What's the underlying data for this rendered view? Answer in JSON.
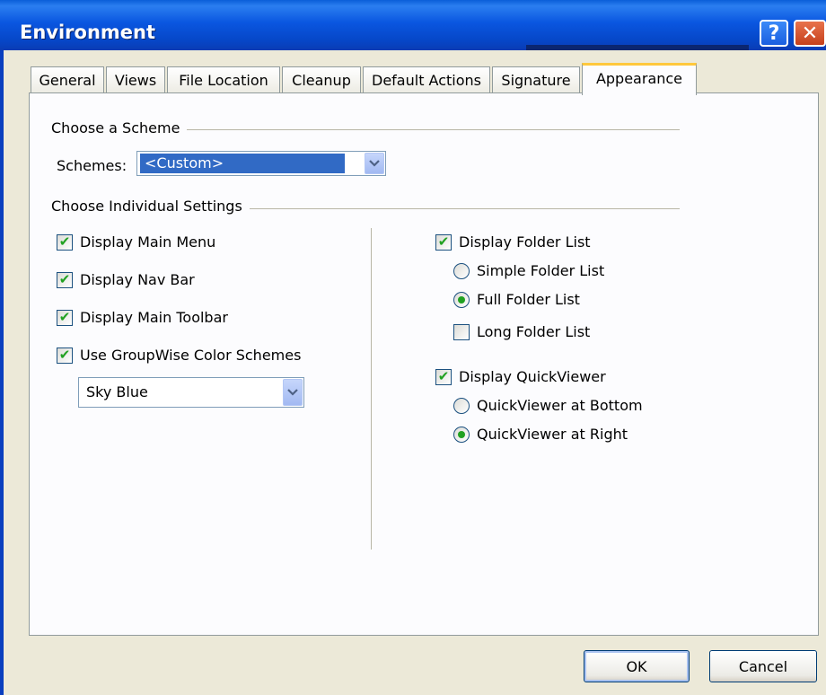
{
  "window": {
    "title": "Environment",
    "help_label": "?",
    "close_label": "✕"
  },
  "tabs": [
    {
      "label": "General"
    },
    {
      "label": "Views"
    },
    {
      "label": "File Location"
    },
    {
      "label": "Cleanup"
    },
    {
      "label": "Default Actions"
    },
    {
      "label": "Signature"
    },
    {
      "label": "Appearance",
      "active": true
    }
  ],
  "scheme": {
    "group_label": "Choose a Scheme",
    "label": "Schemes:",
    "selected": "<Custom>"
  },
  "individual": {
    "group_label": "Choose Individual Settings",
    "left": [
      {
        "label": "Display Main Menu",
        "checked": true
      },
      {
        "label": "Display Nav Bar",
        "checked": true
      },
      {
        "label": "Display Main Toolbar",
        "checked": true
      },
      {
        "label": "Use GroupWise Color Schemes",
        "checked": true
      }
    ],
    "color_scheme_selected": "Sky Blue",
    "folder": {
      "label": "Display Folder List",
      "checked": true,
      "options": [
        {
          "label": "Simple Folder List",
          "selected": false
        },
        {
          "label": "Full Folder List",
          "selected": true
        }
      ],
      "long_list": {
        "label": "Long Folder List",
        "checked": false
      }
    },
    "quickviewer": {
      "label": "Display QuickViewer",
      "checked": true,
      "options": [
        {
          "label": "QuickViewer at Bottom",
          "selected": false
        },
        {
          "label": "QuickViewer at Right",
          "selected": true
        }
      ]
    }
  },
  "buttons": {
    "ok": "OK",
    "cancel": "Cancel"
  },
  "colors": {
    "title_blue": "#0a56e0",
    "check_green": "#21a121",
    "selection": "#316ac5",
    "active_tab_accent": "#ffc83c"
  }
}
